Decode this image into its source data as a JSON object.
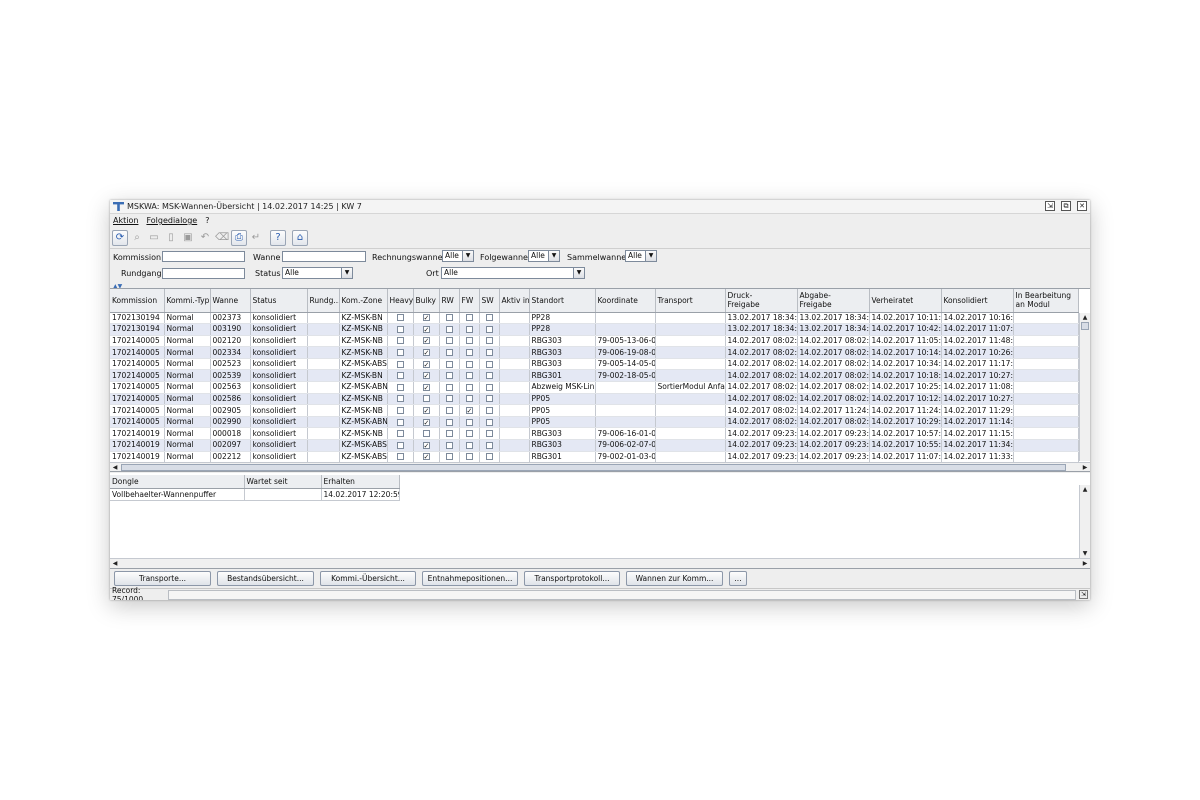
{
  "window": {
    "title": "MSKWA: MSK-Wannen-Übersicht | 14.02.2017 14:25 | KW 7",
    "controls": [
      "⇲",
      "⧉",
      "✕"
    ]
  },
  "menu": {
    "items": [
      "Aktion",
      "Folgedialoge",
      "?"
    ]
  },
  "toolbar": {
    "icons": [
      "refresh-icon",
      "zoom-icon",
      "new-document-icon",
      "copy-document-icon",
      "save-icon",
      "undo-icon",
      "delete-icon",
      "print-icon",
      "return-icon",
      "help-icon",
      "home-icon"
    ],
    "glyphs": [
      "⟳",
      "⌕",
      "▭",
      "▯",
      "▣",
      "↶",
      "⌫",
      "⎙",
      "↵",
      "?",
      "⌂"
    ]
  },
  "filters": {
    "kommission_label": "Kommission",
    "kommission_value": "",
    "wanne_label": "Wanne",
    "wanne_value": "",
    "rechnungswanne_label": "Rechnungswanne",
    "rechnungswanne_value": "Alle",
    "folgewanne_label": "Folgewanne",
    "folgewanne_value": "Alle",
    "sammelwanne_label": "Sammelwanne",
    "sammelwanne_value": "Alle",
    "rundgang_label": "Rundgang",
    "rundgang_value": "",
    "status_label": "Status",
    "status_value": "Alle",
    "ort_label": "Ort",
    "ort_value": "Alle",
    "collapse": "▲▼"
  },
  "grid": {
    "columns": [
      "Kommission",
      "Kommi.-Typ",
      "Wanne",
      "Status",
      "Rundg...",
      "Kom.-Zone",
      "Heavy",
      "Bulky",
      "RW",
      "FW",
      "SW",
      "Aktiv in",
      "Standort",
      "Koordinate",
      "Transport",
      "Druck-\nFreigabe",
      "Abgabe-\nFreigabe",
      "Verheiratet",
      "Konsolidiert",
      "In Bearbeitung\nan Modul"
    ],
    "rows": [
      {
        "kommission": "1702130194",
        "typ": "Normal",
        "wanne": "002373",
        "status": "konsolidiert",
        "rundgang": "",
        "zone": "KZ-MSK-BN",
        "heavy": false,
        "bulky": true,
        "rw": false,
        "fw": false,
        "sw": false,
        "aktiv": "",
        "standort": "PP28",
        "koordinate": "",
        "transport": "",
        "druck": "13.02.2017 18:34:49",
        "abgabe": "13.02.2017 18:34:49",
        "verheiratet": "14.02.2017 10:11:01",
        "konsolidiert": "14.02.2017 10:16:51",
        "bearbeitung": ""
      },
      {
        "kommission": "1702130194",
        "typ": "Normal",
        "wanne": "003190",
        "status": "konsolidiert",
        "rundgang": "",
        "zone": "KZ-MSK-NB",
        "heavy": false,
        "bulky": true,
        "rw": false,
        "fw": false,
        "sw": false,
        "aktiv": "",
        "standort": "PP28",
        "koordinate": "",
        "transport": "",
        "druck": "13.02.2017 18:34:49",
        "abgabe": "13.02.2017 18:34:49",
        "verheiratet": "14.02.2017 10:42:07",
        "konsolidiert": "14.02.2017 11:07:20",
        "bearbeitung": ""
      },
      {
        "kommission": "1702140005",
        "typ": "Normal",
        "wanne": "002120",
        "status": "konsolidiert",
        "rundgang": "",
        "zone": "KZ-MSK-NB",
        "heavy": false,
        "bulky": true,
        "rw": false,
        "fw": false,
        "sw": false,
        "aktiv": "",
        "standort": "RBG303",
        "koordinate": "79-005-13-06-01",
        "transport": "",
        "druck": "14.02.2017 08:02:43",
        "abgabe": "14.02.2017 08:02:43",
        "verheiratet": "14.02.2017 11:05:36",
        "konsolidiert": "14.02.2017 11:48:53",
        "bearbeitung": ""
      },
      {
        "kommission": "1702140005",
        "typ": "Normal",
        "wanne": "002334",
        "status": "konsolidiert",
        "rundgang": "",
        "zone": "KZ-MSK-NB",
        "heavy": false,
        "bulky": true,
        "rw": false,
        "fw": false,
        "sw": false,
        "aktiv": "",
        "standort": "RBG303",
        "koordinate": "79-006-19-08-01",
        "transport": "",
        "druck": "14.02.2017 08:02:43",
        "abgabe": "14.02.2017 08:02:43",
        "verheiratet": "14.02.2017 10:14:14",
        "konsolidiert": "14.02.2017 10:26:11",
        "bearbeitung": ""
      },
      {
        "kommission": "1702140005",
        "typ": "Normal",
        "wanne": "002523",
        "status": "konsolidiert",
        "rundgang": "",
        "zone": "KZ-MSK-ABS",
        "heavy": false,
        "bulky": true,
        "rw": false,
        "fw": false,
        "sw": false,
        "aktiv": "",
        "standort": "RBG303",
        "koordinate": "79-005-14-05-01",
        "transport": "",
        "druck": "14.02.2017 08:02:43",
        "abgabe": "14.02.2017 08:02:43",
        "verheiratet": "14.02.2017 10:34:43",
        "konsolidiert": "14.02.2017 11:17:24",
        "bearbeitung": ""
      },
      {
        "kommission": "1702140005",
        "typ": "Normal",
        "wanne": "002539",
        "status": "konsolidiert",
        "rundgang": "",
        "zone": "KZ-MSK-BN",
        "heavy": false,
        "bulky": true,
        "rw": false,
        "fw": false,
        "sw": false,
        "aktiv": "",
        "standort": "RBG301",
        "koordinate": "79-002-18-05-01",
        "transport": "",
        "druck": "14.02.2017 08:02:43",
        "abgabe": "14.02.2017 08:02:43",
        "verheiratet": "14.02.2017 10:18:11",
        "konsolidiert": "14.02.2017 10:27:19",
        "bearbeitung": ""
      },
      {
        "kommission": "1702140005",
        "typ": "Normal",
        "wanne": "002563",
        "status": "konsolidiert",
        "rundgang": "",
        "zone": "KZ-MSK-ABN",
        "heavy": false,
        "bulky": true,
        "rw": false,
        "fw": false,
        "sw": false,
        "aktiv": "",
        "standort": "Abzweig MSK-Lin...",
        "koordinate": "",
        "transport": "SortierModul Anfahrt",
        "druck": "14.02.2017 08:02:43",
        "abgabe": "14.02.2017 08:02:43",
        "verheiratet": "14.02.2017 10:25:11",
        "konsolidiert": "14.02.2017 11:08:52",
        "bearbeitung": ""
      },
      {
        "kommission": "1702140005",
        "typ": "Normal",
        "wanne": "002586",
        "status": "konsolidiert",
        "rundgang": "",
        "zone": "KZ-MSK-NB",
        "heavy": false,
        "bulky": false,
        "rw": false,
        "fw": false,
        "sw": false,
        "aktiv": "",
        "standort": "PP05",
        "koordinate": "",
        "transport": "",
        "druck": "14.02.2017 08:02:43",
        "abgabe": "14.02.2017 08:02:43",
        "verheiratet": "14.02.2017 10:12:02",
        "konsolidiert": "14.02.2017 10:27:14",
        "bearbeitung": ""
      },
      {
        "kommission": "1702140005",
        "typ": "Normal",
        "wanne": "002905",
        "status": "konsolidiert",
        "rundgang": "",
        "zone": "KZ-MSK-NB",
        "heavy": false,
        "bulky": true,
        "rw": false,
        "fw": true,
        "sw": false,
        "aktiv": "",
        "standort": "PP05",
        "koordinate": "",
        "transport": "",
        "druck": "14.02.2017 08:02:43",
        "abgabe": "14.02.2017 11:24:36",
        "verheiratet": "14.02.2017 11:24:35",
        "konsolidiert": "14.02.2017 11:29:30",
        "bearbeitung": ""
      },
      {
        "kommission": "1702140005",
        "typ": "Normal",
        "wanne": "002990",
        "status": "konsolidiert",
        "rundgang": "",
        "zone": "KZ-MSK-ABN",
        "heavy": false,
        "bulky": true,
        "rw": false,
        "fw": false,
        "sw": false,
        "aktiv": "",
        "standort": "PP05",
        "koordinate": "",
        "transport": "",
        "druck": "14.02.2017 08:02:43",
        "abgabe": "14.02.2017 08:02:43",
        "verheiratet": "14.02.2017 10:29:25",
        "konsolidiert": "14.02.2017 11:14:44",
        "bearbeitung": ""
      },
      {
        "kommission": "1702140019",
        "typ": "Normal",
        "wanne": "000018",
        "status": "konsolidiert",
        "rundgang": "",
        "zone": "KZ-MSK-NB",
        "heavy": false,
        "bulky": false,
        "rw": false,
        "fw": false,
        "sw": false,
        "aktiv": "",
        "standort": "RBG303",
        "koordinate": "79-006-16-01-01",
        "transport": "",
        "druck": "14.02.2017 09:23:13",
        "abgabe": "14.02.2017 09:23:13",
        "verheiratet": "14.02.2017 10:57:36",
        "konsolidiert": "14.02.2017 11:15:24",
        "bearbeitung": ""
      },
      {
        "kommission": "1702140019",
        "typ": "Normal",
        "wanne": "002097",
        "status": "konsolidiert",
        "rundgang": "",
        "zone": "KZ-MSK-ABS",
        "heavy": false,
        "bulky": true,
        "rw": false,
        "fw": false,
        "sw": false,
        "aktiv": "",
        "standort": "RBG303",
        "koordinate": "79-006-02-07-01",
        "transport": "",
        "druck": "14.02.2017 09:23:13",
        "abgabe": "14.02.2017 09:23:13",
        "verheiratet": "14.02.2017 10:55:43",
        "konsolidiert": "14.02.2017 11:34:37",
        "bearbeitung": ""
      },
      {
        "kommission": "1702140019",
        "typ": "Normal",
        "wanne": "002212",
        "status": "konsolidiert",
        "rundgang": "",
        "zone": "KZ-MSK-ABS",
        "heavy": false,
        "bulky": true,
        "rw": false,
        "fw": false,
        "sw": false,
        "aktiv": "",
        "standort": "RBG301",
        "koordinate": "79-002-01-03-01",
        "transport": "",
        "druck": "14.02.2017 09:23:13",
        "abgabe": "14.02.2017 09:23:13",
        "verheiratet": "14.02.2017 11:07:44",
        "konsolidiert": "14.02.2017 11:33:53",
        "bearbeitung": ""
      }
    ]
  },
  "detail": {
    "columns": [
      "Dongle",
      "Wartet seit",
      "Erhalten"
    ],
    "rows": [
      {
        "dongle": "Vollbehaelter-Wannenpuffer",
        "wartet": "",
        "erhalten": "14.02.2017 12:20:59"
      }
    ]
  },
  "buttons": [
    "Transporte...",
    "Bestandsübersicht...",
    "Kommi.-Übersicht...",
    "Entnahmepositionen...",
    "Transportprotokoll...",
    "Wannen zur Komm...",
    "..."
  ],
  "status": {
    "record": "Record: 75/1000",
    "grip": "⇲"
  },
  "scroll": {
    "up": "▲",
    "down": "▼",
    "left": "◀",
    "right": "▶"
  }
}
